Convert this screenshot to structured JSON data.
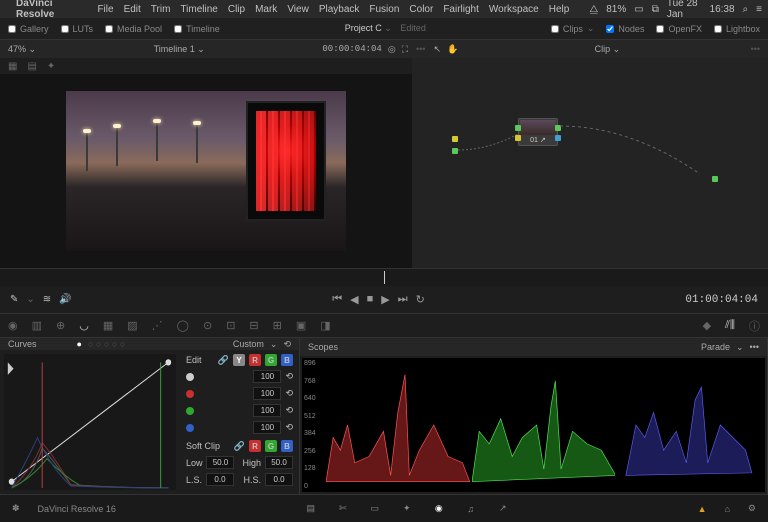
{
  "menubar": {
    "apple": "",
    "app": "DaVinci Resolve",
    "items": [
      "File",
      "Edit",
      "Trim",
      "Timeline",
      "Clip",
      "Mark",
      "View",
      "Playback",
      "Fusion",
      "Color",
      "Fairlight",
      "Workspace",
      "Help"
    ],
    "wifi_pct": "81%",
    "date": "Tue 28 Jan",
    "time": "16:38"
  },
  "toolbar": {
    "gallery": "Gallery",
    "luts": "LUTs",
    "mediapool": "Media Pool",
    "timeline": "Timeline",
    "project": "Project C",
    "edited": "Edited",
    "clips": "Clips",
    "nodes": "Nodes",
    "openfx": "OpenFX",
    "lightbox": "Lightbox"
  },
  "viewer": {
    "zoom": "47%",
    "title": "Timeline 1",
    "timecode": "00:00:04:04",
    "clip_label": "Clip"
  },
  "transport": {
    "timecode": "01:00:04:04"
  },
  "curves": {
    "title": "Curves",
    "mode": "Custom",
    "edit_label": "Edit",
    "softclip_label": "Soft Clip",
    "channels": [
      "Y",
      "R",
      "G",
      "B"
    ],
    "values": {
      "white": "100",
      "red": "100",
      "green": "100",
      "blue": "100"
    },
    "low_label": "Low",
    "low_val": "50.0",
    "high_label": "High",
    "high_val": "50.0",
    "ls_label": "L.S.",
    "ls_val": "0.0",
    "hs_label": "H.S.",
    "hs_val": "0.0"
  },
  "scopes": {
    "title": "Scopes",
    "mode": "Parade",
    "scale": [
      "896",
      "768",
      "640",
      "512",
      "384",
      "256",
      "128",
      "0"
    ]
  },
  "nodes": {
    "node1": "01"
  },
  "bottom": {
    "app_label": "DaVinci Resolve 16"
  }
}
